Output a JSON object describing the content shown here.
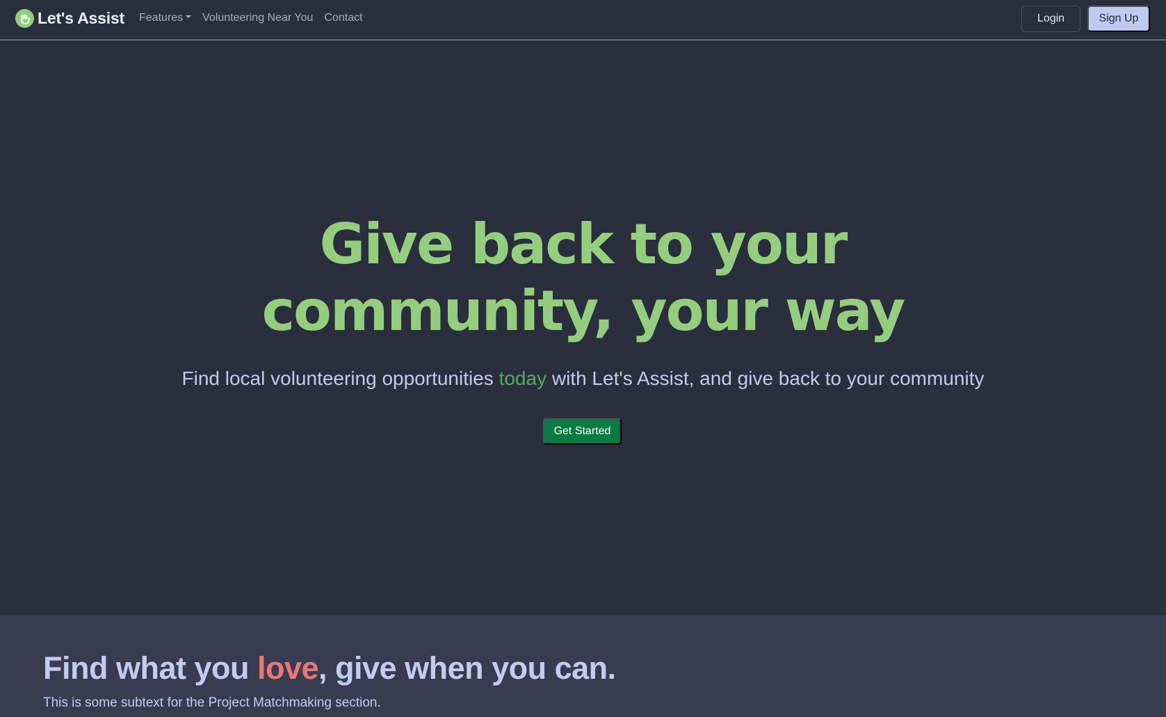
{
  "navbar": {
    "brand": "Let's Assist",
    "links": [
      {
        "label": "Features",
        "has_dropdown": true
      },
      {
        "label": "Volunteering Near You"
      },
      {
        "label": "Contact"
      }
    ],
    "login_label": "Login",
    "signup_label": "Sign Up",
    "logo_icon": "hand-wave-icon"
  },
  "hero": {
    "title_line1": "Give back to your",
    "title_line2": "community, your way",
    "subtitle_before": "Find local volunteering opportunities ",
    "subtitle_accent": "today",
    "subtitle_after": " with Let's Assist, and give back to your community",
    "cta_label": "Get Started"
  },
  "matchmaking": {
    "title_before": "Find what you ",
    "title_accent": "love",
    "title_after": ", give when you can.",
    "subtext": "This is some subtext for the Project Matchmaking section."
  },
  "colors": {
    "background": "#2b2e3d",
    "hero_title": "#95cd7f",
    "accent_green": "#53ad5f",
    "cta_green": "#087a43",
    "love_red": "#e97777",
    "signup_bg": "#bfcaf2",
    "section_bg": "#393c51"
  }
}
